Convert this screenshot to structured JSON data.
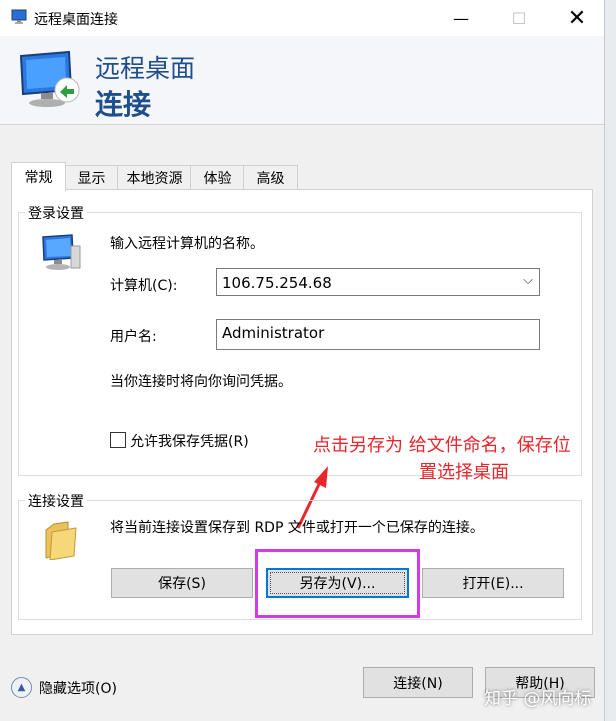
{
  "window": {
    "title": "远程桌面连接",
    "min_glyph": "—",
    "max_glyph": "☐",
    "close_glyph": "✕"
  },
  "header": {
    "title_line1": "远程桌面",
    "title_line2": "连接"
  },
  "tabs": [
    {
      "label": "常规",
      "active": true
    },
    {
      "label": "显示"
    },
    {
      "label": "本地资源"
    },
    {
      "label": "体验"
    },
    {
      "label": "高级"
    }
  ],
  "login_settings": {
    "legend": "登录设置",
    "instruction": "输入远程计算机的名称。",
    "computer_label": "计算机(C):",
    "computer_value": "106.75.254.68",
    "username_label": "用户名:",
    "username_value": "Administrator",
    "credential_note": "当你连接时将向你询问凭据。",
    "save_credentials_label": "允许我保存凭据(R)",
    "save_credentials_checked": false
  },
  "connection_settings": {
    "legend": "连接设置",
    "instruction": "将当前连接设置保存到 RDP 文件或打开一个已保存的连接。",
    "save_label": "保存(S)",
    "save_as_label": "另存为(V)...",
    "open_label": "打开(E)..."
  },
  "annotation": {
    "line1": "点击另存为 给文件命名，保存位",
    "line2": "置选择桌面",
    "text_color": "#e8262c",
    "highlight_color": "#d43be6"
  },
  "footer": {
    "hide_options_label": "隐藏选项(O)",
    "connect_label": "连接(N)",
    "help_label": "帮助(H)"
  },
  "watermark": "知乎 @风向标",
  "colors": {
    "header_blue": "#1e4e8c",
    "focus_blue": "#0078d7"
  }
}
